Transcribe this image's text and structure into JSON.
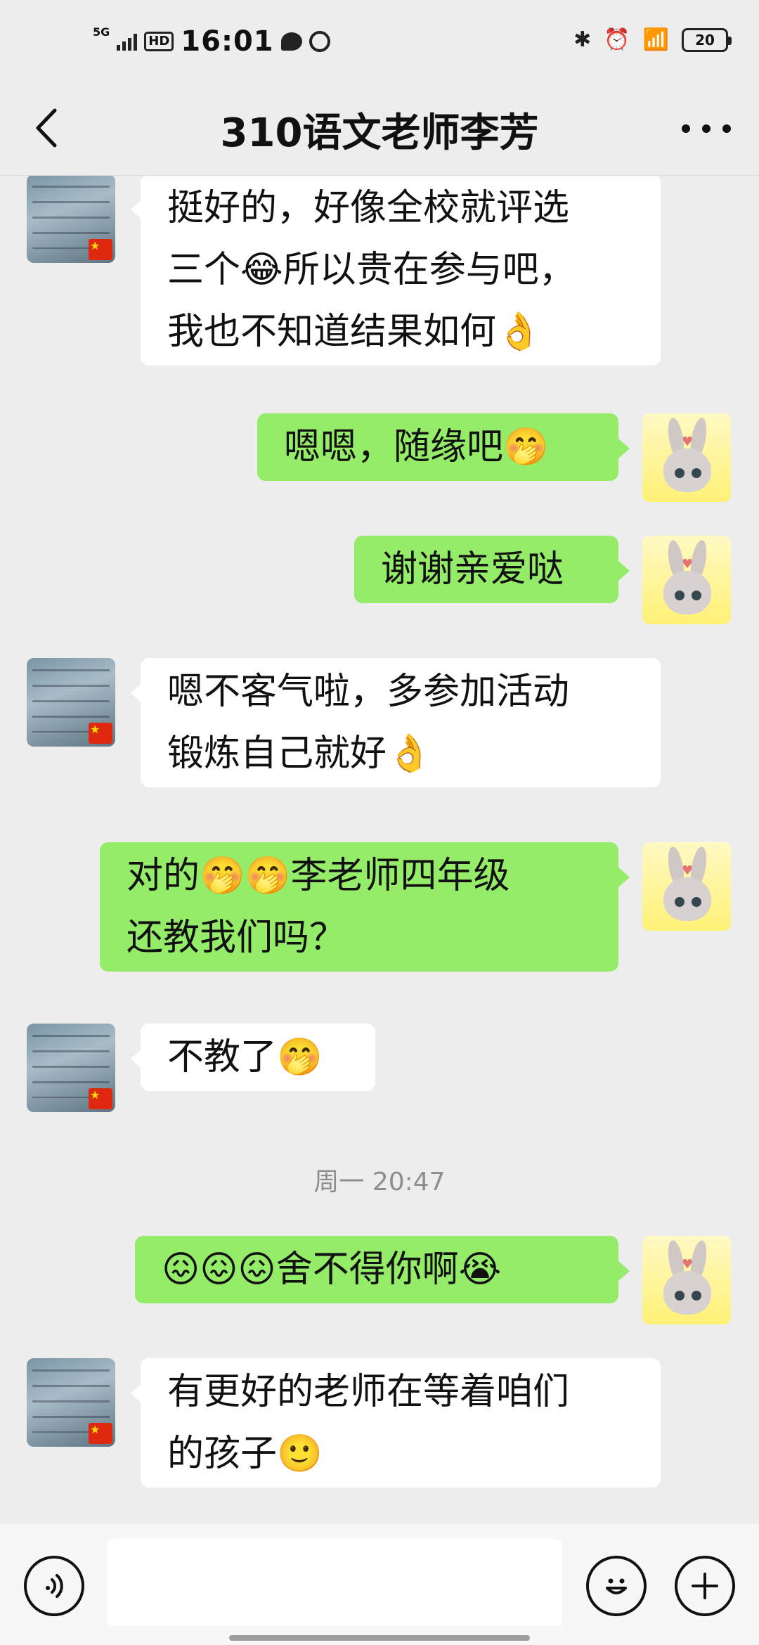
{
  "status_bar": {
    "network": "5G",
    "hd": "HD",
    "time": "16:01",
    "bluetooth_icon": "✱",
    "alarm_icon": "⏰",
    "wifi_icon": "📶",
    "battery": "20"
  },
  "header": {
    "title": "310语文老师李芳"
  },
  "messages": [
    {
      "side": "in",
      "text_lines": [
        "挺好的，好像全校就评选",
        "三个😂所以贵在参与吧，",
        "我也不知道结果如何👌"
      ]
    },
    {
      "side": "out",
      "text_lines": [
        "嗯嗯，随缘吧🤭"
      ]
    },
    {
      "side": "out",
      "text_lines": [
        "谢谢亲爱哒"
      ]
    },
    {
      "side": "in",
      "text_lines": [
        "嗯不客气啦，多参加活动",
        "锻炼自己就好👌"
      ]
    },
    {
      "side": "out",
      "text_lines": [
        "对的🤭🤭李老师四年级",
        "还教我们吗？"
      ]
    },
    {
      "side": "in",
      "text_lines": [
        "不教了🤭"
      ]
    },
    {
      "timestamp": "周一 20:47"
    },
    {
      "side": "out",
      "text_lines": [
        "😖😖😖舍不得你啊😭"
      ]
    },
    {
      "side": "in",
      "text_lines": [
        "有更好的老师在等着咱们",
        "的孩子🙂"
      ]
    }
  ],
  "input": {
    "value": "",
    "placeholder": ""
  },
  "colors": {
    "background": "#ededed",
    "outgoing_bubble": "#95ec69",
    "incoming_bubble": "#ffffff"
  }
}
